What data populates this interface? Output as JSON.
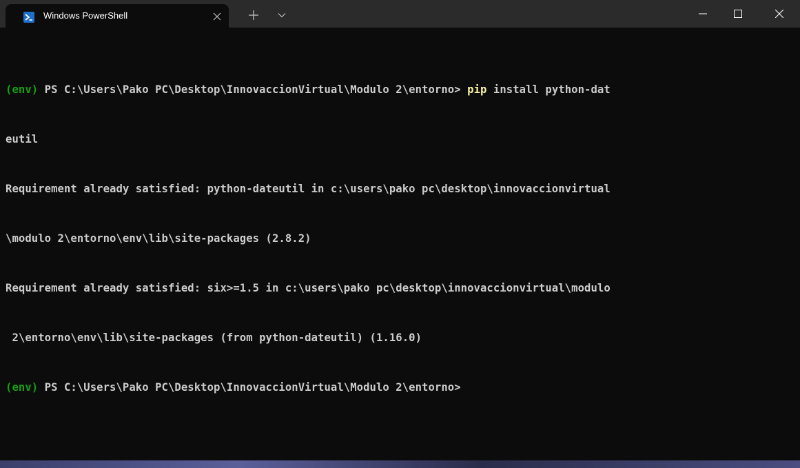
{
  "titlebar": {
    "tab_title": "Windows PowerShell",
    "icons": {
      "tab_icon": "powershell-icon",
      "tab_close": "close-icon",
      "new_tab": "plus-icon",
      "dropdown": "chevron-down-icon",
      "minimize": "minimize-icon",
      "maximize": "maximize-icon",
      "close": "close-icon"
    }
  },
  "terminal": {
    "lines": [
      {
        "env": "(env)",
        "prompt": " PS C:\\Users\\Pako PC\\Desktop\\InnovaccionVirtual\\Modulo 2\\entorno> ",
        "cmd": "pip",
        "rest": " install python-dat"
      },
      {
        "text": "eutil"
      },
      {
        "text": "Requirement already satisfied: python-dateutil in c:\\users\\pako pc\\desktop\\innovaccionvirtual"
      },
      {
        "text": "\\modulo 2\\entorno\\env\\lib\\site-packages (2.8.2)"
      },
      {
        "text": "Requirement already satisfied: six>=1.5 in c:\\users\\pako pc\\desktop\\innovaccionvirtual\\modulo"
      },
      {
        "text": " 2\\entorno\\env\\lib\\site-packages (from python-dateutil) (1.16.0)"
      },
      {
        "env": "(env)",
        "prompt": " PS C:\\Users\\Pako PC\\Desktop\\InnovaccionVirtual\\Modulo 2\\entorno>",
        "cmd": "",
        "rest": ""
      }
    ]
  },
  "colors": {
    "background": "#0c0c0c",
    "titlebar": "#2b2b2b",
    "env_green": "#13a10e",
    "command_yellow": "#f9f1a5",
    "text": "#cccccc"
  }
}
